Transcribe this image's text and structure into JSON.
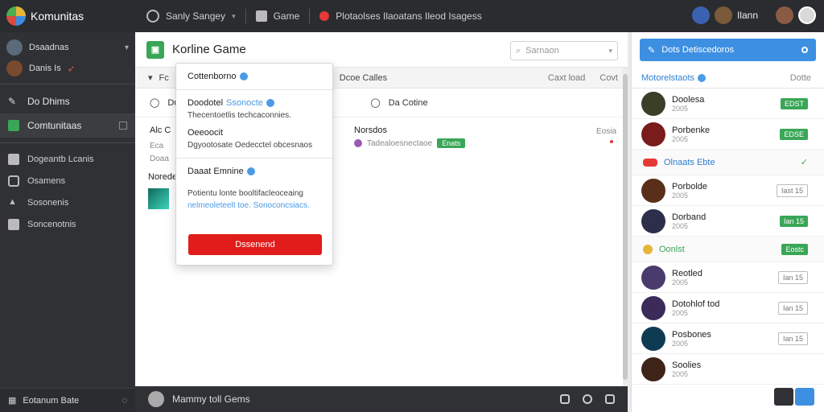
{
  "app": {
    "title": "Komunitas"
  },
  "topbar": {
    "nav": [
      "Sanly Sangey",
      "Game",
      "Plotaolses Ilaoatans Ileod Isagess"
    ],
    "user_label": "Ilann"
  },
  "sidebar": {
    "users": [
      {
        "name": "Dsaadnas"
      },
      {
        "name": "Danis Is"
      }
    ],
    "items": [
      {
        "label": "Do Dhims"
      },
      {
        "label": "Comtunitaas",
        "active": true
      }
    ],
    "sub_items": [
      {
        "label": "Dogeantb Lcanis"
      },
      {
        "label": "Osamens"
      },
      {
        "label": "Sosonenis"
      },
      {
        "label": "Soncenotnis"
      }
    ],
    "bottom_label": "Eotanum Bate"
  },
  "main": {
    "title": "Korline Game",
    "search_placeholder": "Sarnaon",
    "subbar": {
      "left": "Fc",
      "middle": "Dcoe Calles",
      "r1": "Caxt load",
      "r2": "Covt"
    },
    "row2": {
      "left": "Du",
      "right": "Da Cotine"
    },
    "post1": {
      "title": "Alc C",
      "sub": "Eca",
      "sub2": "Doaa",
      "section": "Noreden"
    },
    "post2": {
      "title": "Norsdos",
      "sub": "Tadealoesnectaoe",
      "tag": "Enats",
      "time": "Eosia"
    },
    "bottombar_label": "Mammy toll Gems"
  },
  "dropdown": {
    "title": "Cottenborno",
    "item1": {
      "title": "Doodotel",
      "link": "Ssonocte",
      "line": "Thecentoetlis techcaconnies."
    },
    "item2": {
      "title": "Oeeoocit",
      "line": "Dgyootosate Oedecctel obcesnaos"
    },
    "item3": {
      "title": "Daaat Emnine"
    },
    "desc": "Potientu lonte booltifacleoceaing",
    "desc_link": "nelmeoleteelt toe. Sonoconcsiacs.",
    "button": "Dssenend"
  },
  "rpanel": {
    "top_button": "Dots Detiscedoros",
    "section_title": "Motorelstaots",
    "section_tail": "Dotte",
    "friends": [
      {
        "name": "Doolesa",
        "sub": "2005",
        "btn": "EDST",
        "btn_style": "green",
        "c": "#3b3f28"
      },
      {
        "name": "Porbenke",
        "sub": "2005",
        "btn": "EDSE",
        "btn_style": "green",
        "c": "#7a1c1c"
      },
      {
        "name": "Porbolde",
        "sub": "2005",
        "btn": "Iast 15",
        "btn_style": "outline",
        "c": "#5a2f1a"
      },
      {
        "name": "Dorband",
        "sub": "2005",
        "btn": "Ian 15",
        "btn_style": "green",
        "c": "#2d2f4a"
      },
      {
        "name": "Reotled",
        "sub": "2005",
        "btn": "Ian 15",
        "btn_style": "outline",
        "c": "#4a3b6e"
      },
      {
        "name": "Dotohlof tod",
        "sub": "2005",
        "btn": "Ian 15",
        "btn_style": "outline",
        "c": "#3c2a5a"
      },
      {
        "name": "Posbones",
        "sub": "2005",
        "btn": "Ian 15",
        "btn_style": "outline",
        "c": "#0f3b52"
      },
      {
        "name": "Soolies",
        "sub": "2005",
        "btn": "",
        "btn_style": "outline",
        "c": "#3e2418"
      }
    ],
    "group1": "Olnaats Ebte",
    "group2": "Oonlst",
    "group2_btn": "Eostc"
  },
  "colors": {
    "accent": "#3d8fe2",
    "green": "#3aa657",
    "danger": "#e21b1b"
  }
}
